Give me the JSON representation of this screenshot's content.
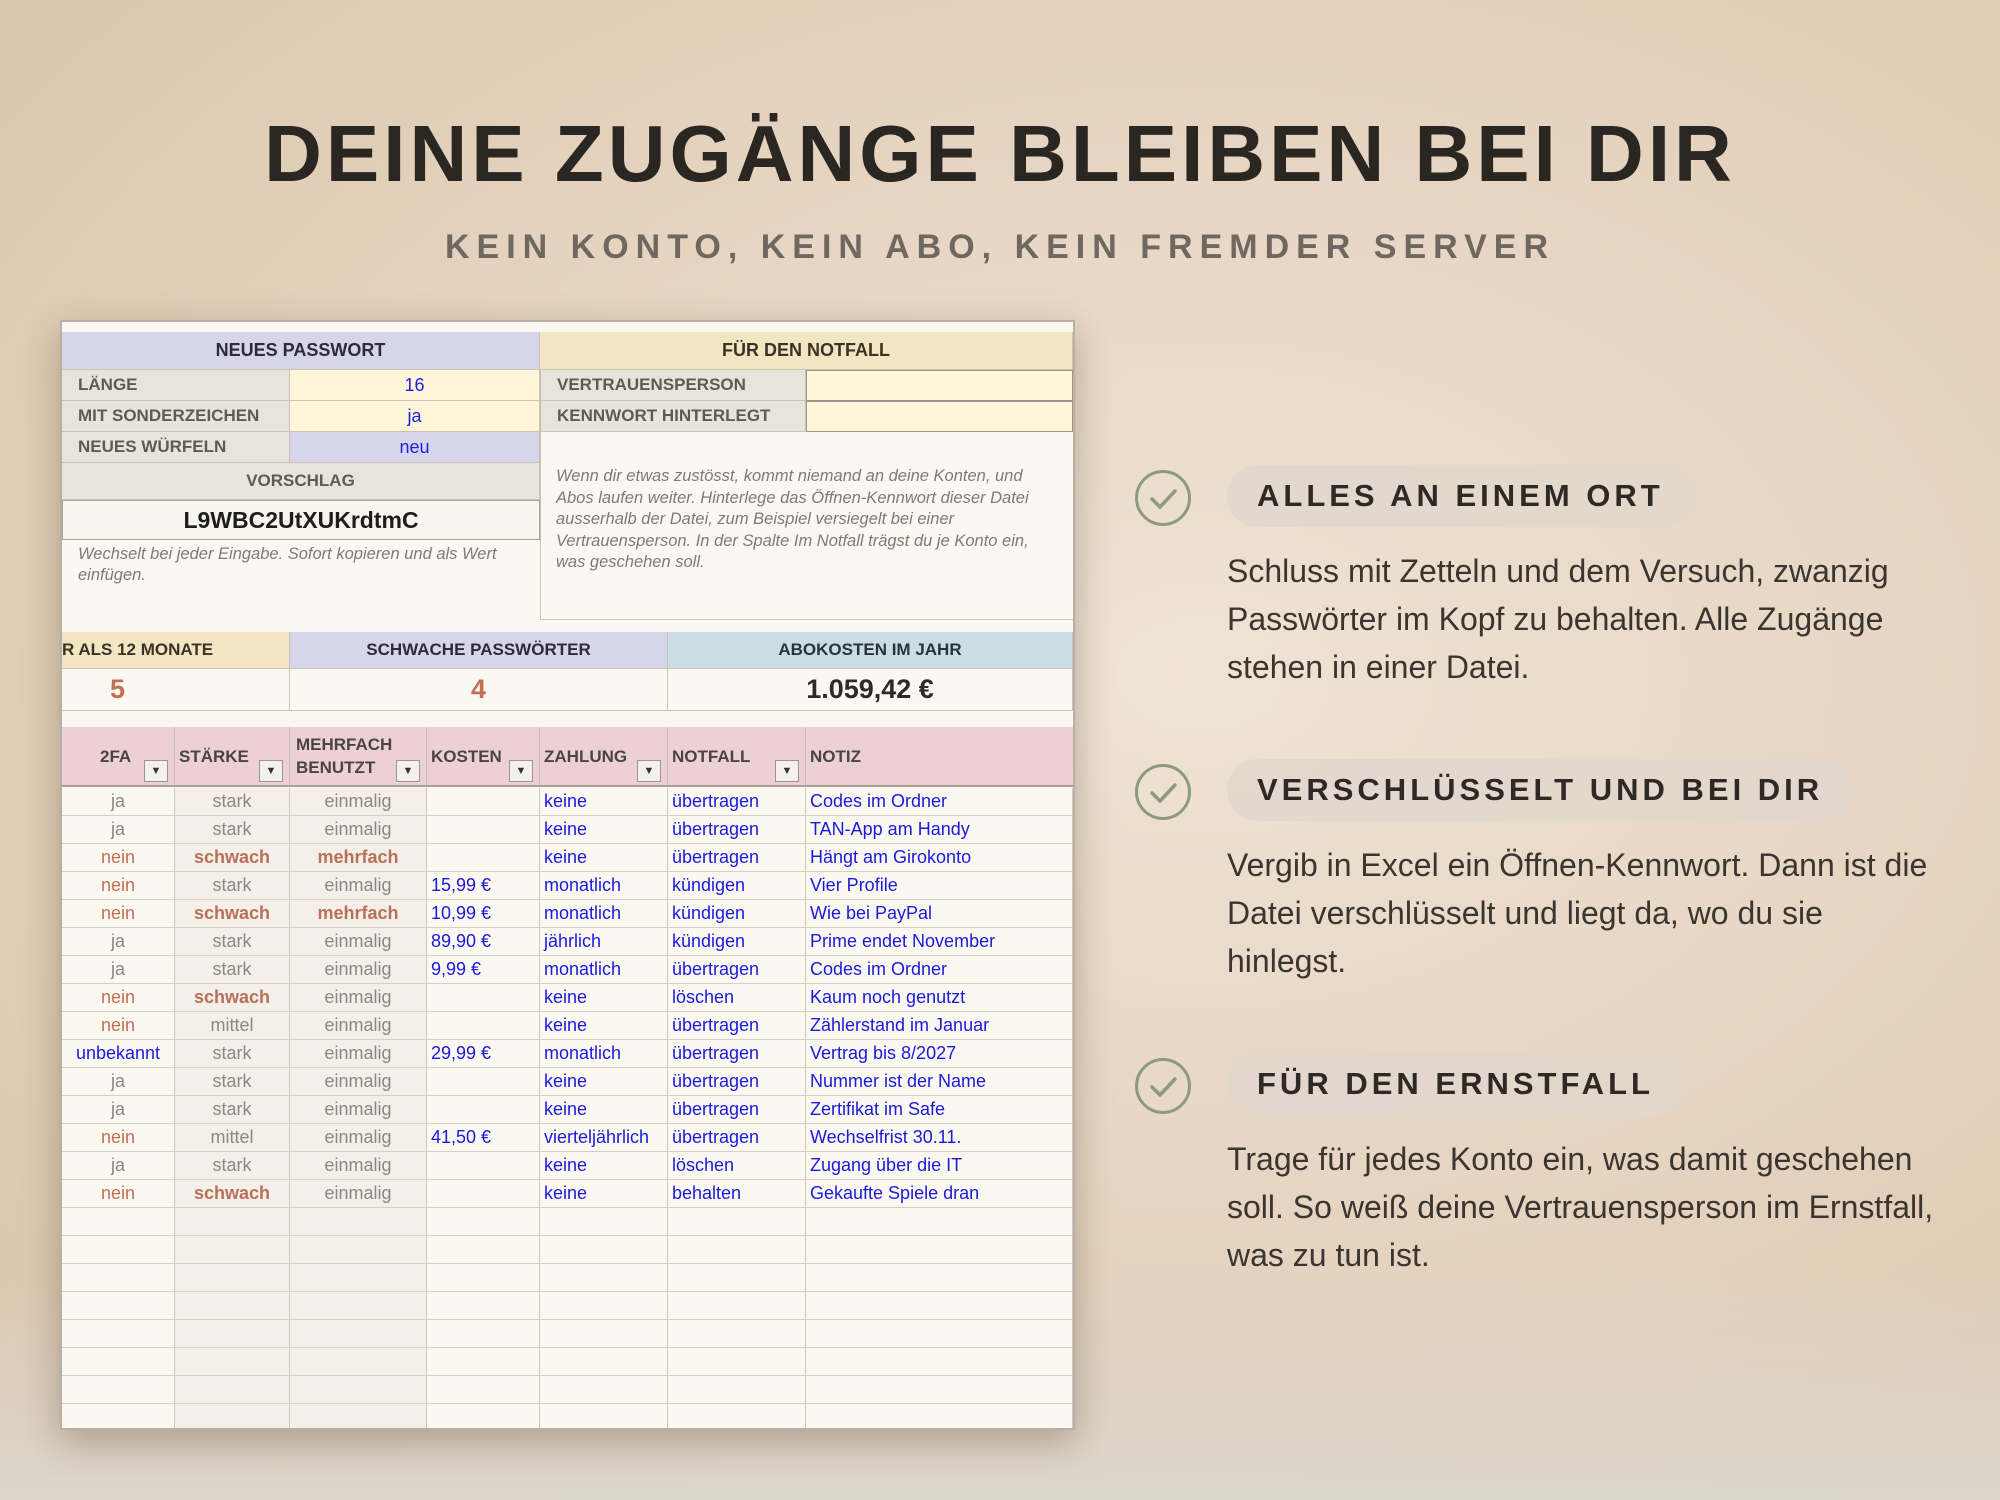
{
  "headline": "DEINE ZUGÄNGE BLEIBEN BEI DIR",
  "subline": "KEIN KONTO, KEIN ABO, KEIN FREMDER SERVER",
  "sheet": {
    "pw": {
      "header": "NEUES PASSWORT",
      "length_label": "LÄNGE",
      "length_value": "16",
      "special_label": "MIT SONDERZEICHEN",
      "special_value": "ja",
      "roll_label": "NEUES WÜRFELN",
      "roll_value": "neu",
      "suggest_label": "VORSCHLAG",
      "suggest_value": "L9WBC2UtXUKrdtmC",
      "note": "Wechselt bei jeder Eingabe. Sofort kopieren und als Wert einfügen."
    },
    "emergency": {
      "header": "FÜR DEN NOTFALL",
      "trust_label": "VERTRAUENSPERSON",
      "trust_value": "",
      "pwset_label": "KENNWORT HINTERLEGT",
      "pwset_value": "",
      "note": "Wenn dir etwas zustösst, kommt niemand an deine Konten, und Abos laufen weiter. Hinterlege das Öffnen-Kennwort dieser Datei ausserhalb der Datei, zum Beispiel versiegelt bei einer Vertrauensperson. In der Spalte Im Notfall trägst du je Konto ein, was geschehen soll."
    },
    "stats": {
      "old_label": "R ALS 12 MONATE",
      "old_value": "5",
      "weak_label": "SCHWACHE PASSWÖRTER",
      "weak_value": "4",
      "cost_label": "ABOKOSTEN IM JAHR",
      "cost_value": "1.059,42 €"
    },
    "columns": {
      "c2fa": "2FA",
      "strength": "STÄRKE",
      "multi_1": "MEHRFACH",
      "multi_2": "BENUTZT",
      "cost": "KOSTEN",
      "payment": "ZAHLUNG",
      "emergency": "NOTFALL",
      "note": "NOTIZ"
    },
    "rows": [
      {
        "tfa": "ja",
        "strength": "stark",
        "multi": "einmalig",
        "cost": "",
        "payment": "keine",
        "emergency": "übertragen",
        "note": "Codes im Ordner"
      },
      {
        "tfa": "ja",
        "strength": "stark",
        "multi": "einmalig",
        "cost": "",
        "payment": "keine",
        "emergency": "übertragen",
        "note": "TAN-App am Handy"
      },
      {
        "tfa": "nein",
        "strength": "schwach",
        "multi": "mehrfach",
        "cost": "",
        "payment": "keine",
        "emergency": "übertragen",
        "note": "Hängt am Girokonto"
      },
      {
        "tfa": "nein",
        "strength": "stark",
        "multi": "einmalig",
        "cost": "15,99 €",
        "payment": "monatlich",
        "emergency": "kündigen",
        "note": "Vier Profile"
      },
      {
        "tfa": "nein",
        "strength": "schwach",
        "multi": "mehrfach",
        "cost": "10,99 €",
        "payment": "monatlich",
        "emergency": "kündigen",
        "note": "Wie bei PayPal"
      },
      {
        "tfa": "ja",
        "strength": "stark",
        "multi": "einmalig",
        "cost": "89,90 €",
        "payment": "jährlich",
        "emergency": "kündigen",
        "note": "Prime endet November"
      },
      {
        "tfa": "ja",
        "strength": "stark",
        "multi": "einmalig",
        "cost": "9,99 €",
        "payment": "monatlich",
        "emergency": "übertragen",
        "note": "Codes im Ordner"
      },
      {
        "tfa": "nein",
        "strength": "schwach",
        "multi": "einmalig",
        "cost": "",
        "payment": "keine",
        "emergency": "löschen",
        "note": "Kaum noch genutzt"
      },
      {
        "tfa": "nein",
        "strength": "mittel",
        "multi": "einmalig",
        "cost": "",
        "payment": "keine",
        "emergency": "übertragen",
        "note": "Zählerstand im Januar"
      },
      {
        "tfa": "unbekannt",
        "strength": "stark",
        "multi": "einmalig",
        "cost": "29,99 €",
        "payment": "monatlich",
        "emergency": "übertragen",
        "note": "Vertrag bis 8/2027"
      },
      {
        "tfa": "ja",
        "strength": "stark",
        "multi": "einmalig",
        "cost": "",
        "payment": "keine",
        "emergency": "übertragen",
        "note": "Nummer ist der Name"
      },
      {
        "tfa": "ja",
        "strength": "stark",
        "multi": "einmalig",
        "cost": "",
        "payment": "keine",
        "emergency": "übertragen",
        "note": "Zertifikat im Safe"
      },
      {
        "tfa": "nein",
        "strength": "mittel",
        "multi": "einmalig",
        "cost": "41,50 €",
        "payment": "vierteljährlich",
        "emergency": "übertragen",
        "note": "Wechselfrist 30.11."
      },
      {
        "tfa": "ja",
        "strength": "stark",
        "multi": "einmalig",
        "cost": "",
        "payment": "keine",
        "emergency": "löschen",
        "note": "Zugang über die IT"
      },
      {
        "tfa": "nein",
        "strength": "schwach",
        "multi": "einmalig",
        "cost": "",
        "payment": "keine",
        "emergency": "behalten",
        "note": "Gekaufte Spiele dran"
      }
    ]
  },
  "features": [
    {
      "title": "ALLES AN EINEM ORT",
      "icon": "check-circle-icon",
      "text": "Schluss mit Zetteln und dem Versuch, zwanzig Passwörter im Kopf zu behalten. Alle Zugänge stehen in einer Datei."
    },
    {
      "title": "VERSCHLÜSSELT UND BEI DIR",
      "icon": "check-circle-icon",
      "text": "Vergib in Excel ein Öffnen-Kennwort. Dann ist die Datei verschlüsselt und liegt da, wo du sie hinlegst."
    },
    {
      "title": "FÜR DEN ERNSTFALL",
      "icon": "check-circle-icon",
      "text": "Trage für jedes Konto ein, was damit geschehen soll. So weiß deine Vertrauensperson im Ernstfall, was zu tun ist."
    }
  ],
  "colors": {
    "accent_green": "#8c9b7c",
    "link_blue": "#1a1adc",
    "warn_orange": "#c26f55"
  }
}
